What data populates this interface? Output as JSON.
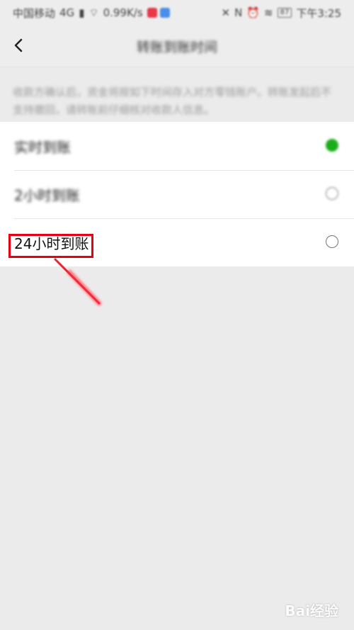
{
  "status_bar": {
    "carrier": "中国移动",
    "network": "4G",
    "speed": "0.99K/s",
    "battery": "87",
    "time": "下午3:25"
  },
  "nav": {
    "title": "转账到账时间"
  },
  "description": "收款方确认后，资金将按如下时间存入对方零钱账户。转账发起后不支持撤回，请转账前仔细核对收款人信息。",
  "options": [
    {
      "label": "实时到账",
      "selected": true
    },
    {
      "label": "2小时到账",
      "selected": false
    },
    {
      "label": "24小时到账",
      "selected": false
    }
  ],
  "colors": {
    "accent": "#1aad19",
    "highlight": "#e50012",
    "background": "#ebebeb"
  },
  "watermark": "Bai经验"
}
